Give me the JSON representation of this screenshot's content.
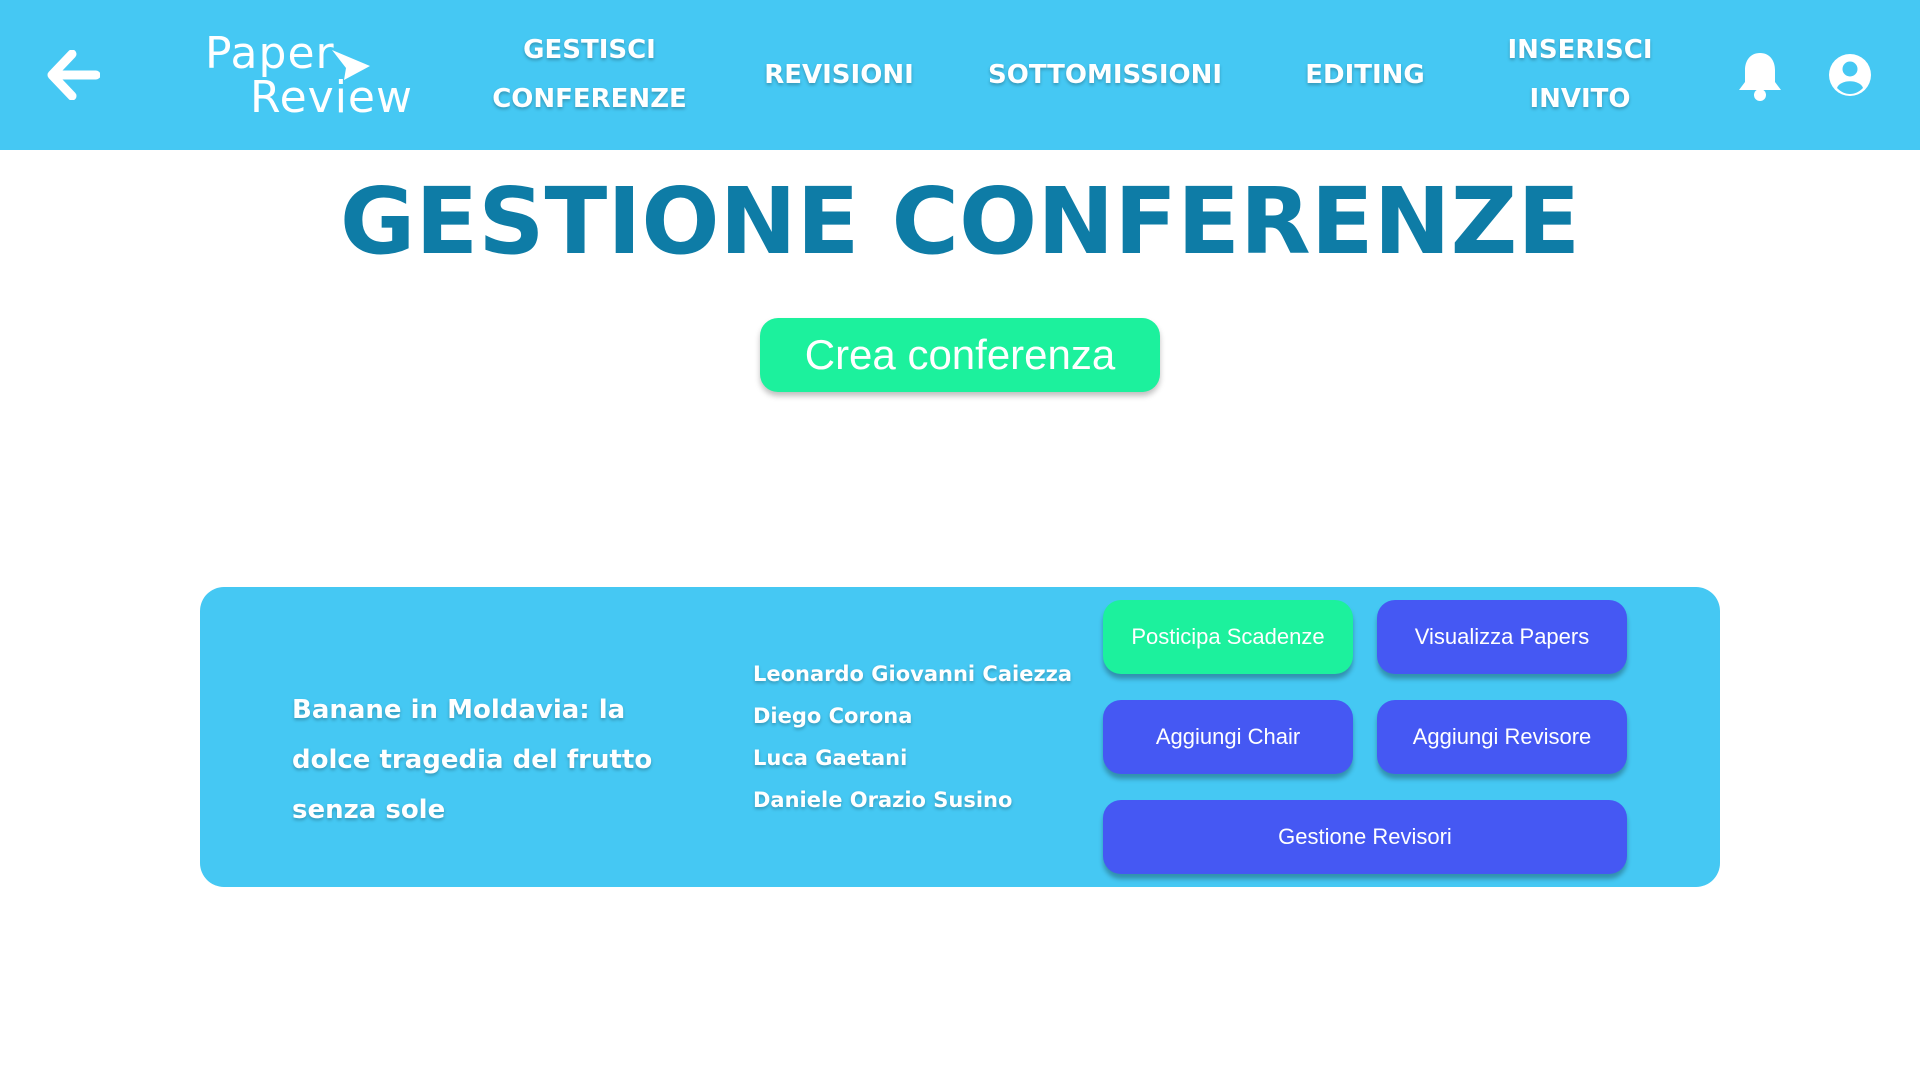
{
  "header": {
    "logo": {
      "line1": "Paper",
      "line2": "Review"
    },
    "nav": {
      "gestisci_line1": "GESTISCI",
      "gestisci_line2": "CONFERENZE",
      "revisioni": "REVISIONI",
      "sottomissioni": "SOTTOMISSIONI",
      "editing": "EDITING",
      "inserisci_line1": "INSERISCI",
      "inserisci_line2": "INVITO"
    },
    "icons": [
      "arrow-left-icon",
      "bell-icon",
      "account-circle-icon"
    ]
  },
  "main": {
    "title": "GESTIONE CONFERENZE",
    "create_button": "Crea conferenza"
  },
  "conference": {
    "title": "Banane in Moldavia: la dolce tragedia del frutto senza sole",
    "authors": [
      "Leonardo Giovanni Caiezza",
      "Diego Corona",
      "Luca Gaetani",
      "Daniele Orazio Susino"
    ],
    "buttons": {
      "posticipa": "Posticipa Scadenze",
      "visualizza": "Visualizza Papers",
      "chair": "Aggiungi Chair",
      "revisore": "Aggiungi Revisore",
      "gestione": "Gestione Revisori"
    }
  },
  "colors": {
    "header_bg": "#45c8f3",
    "title": "#0e7ca6",
    "green_button": "#1cf19d",
    "blue_button": "#4558f3"
  }
}
